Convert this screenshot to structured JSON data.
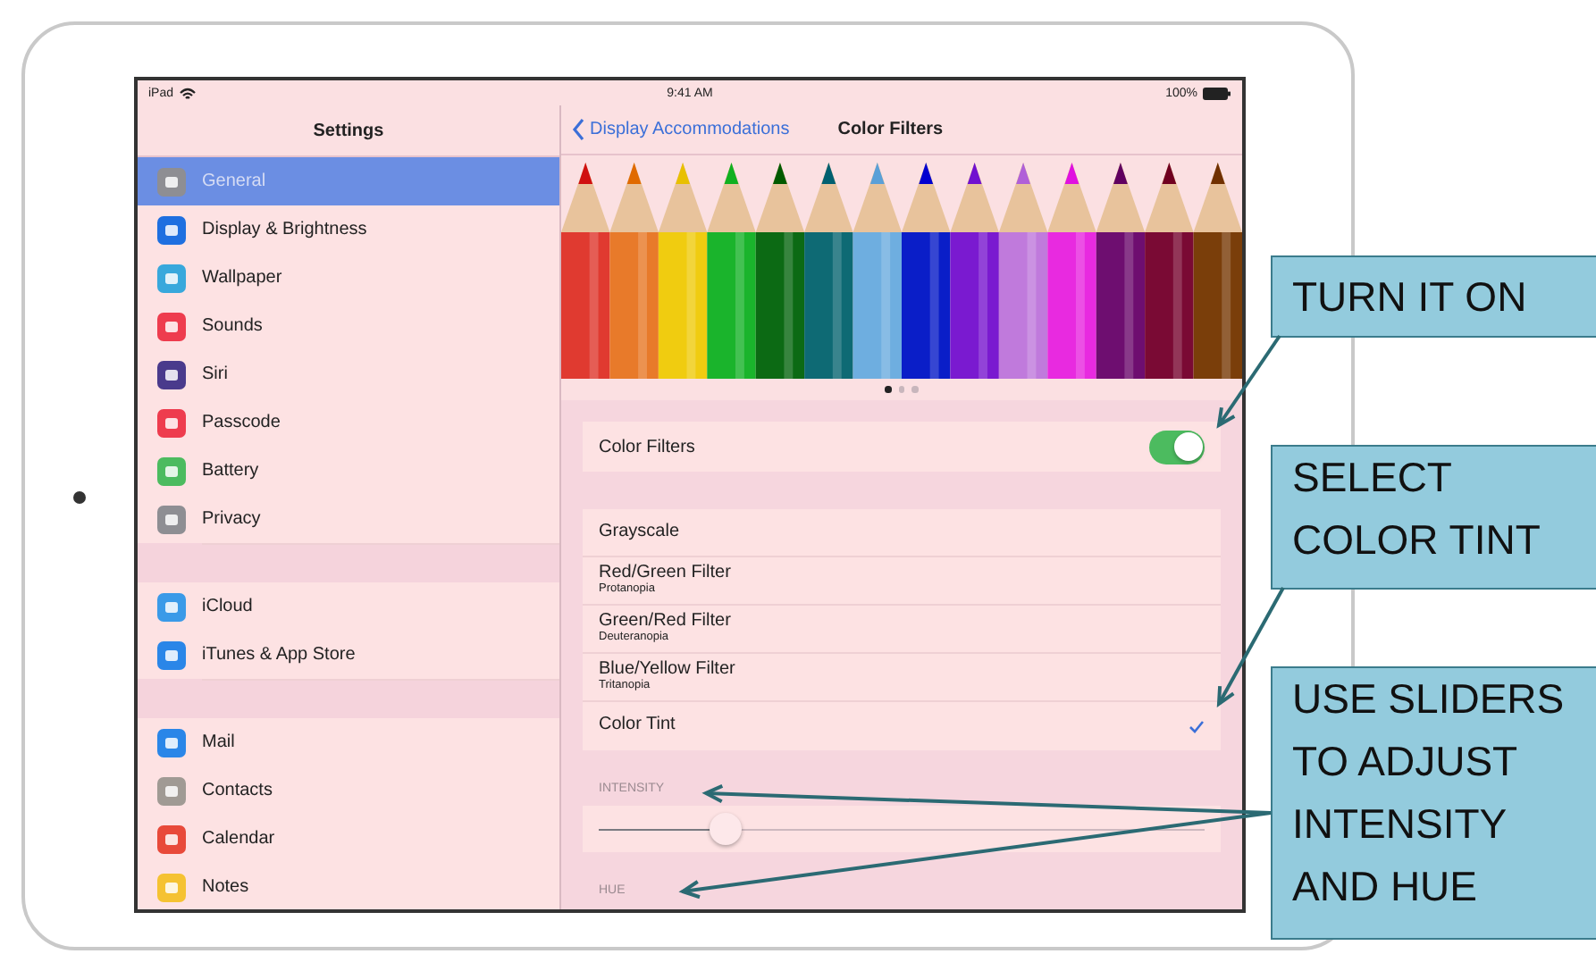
{
  "status_bar": {
    "device": "iPad",
    "time": "9:41 AM",
    "battery": "100%"
  },
  "sidebar": {
    "title": "Settings",
    "groups": [
      {
        "items": [
          {
            "label": "General",
            "color": "#8e8e93",
            "selected": true
          },
          {
            "label": "Display & Brightness",
            "color": "#1e6fe0",
            "selected": false
          },
          {
            "label": "Wallpaper",
            "color": "#38a8dc",
            "selected": false
          },
          {
            "label": "Sounds",
            "color": "#ee3c4e",
            "selected": false
          },
          {
            "label": "Siri",
            "color": "#4a3a8c",
            "selected": false
          },
          {
            "label": "Passcode",
            "color": "#ee3c4e",
            "selected": false
          },
          {
            "label": "Battery",
            "color": "#4cbb5f",
            "selected": false
          },
          {
            "label": "Privacy",
            "color": "#8e8e93",
            "selected": false
          }
        ]
      },
      {
        "items": [
          {
            "label": "iCloud",
            "color": "#3a9ae8",
            "selected": false
          },
          {
            "label": "iTunes & App Store",
            "color": "#2a86e8",
            "selected": false
          }
        ]
      },
      {
        "items": [
          {
            "label": "Mail",
            "color": "#2a86e8",
            "selected": false
          },
          {
            "label": "Contacts",
            "color": "#a09a94",
            "selected": false
          },
          {
            "label": "Calendar",
            "color": "#e84a3a",
            "selected": false
          },
          {
            "label": "Notes",
            "color": "#f5c232",
            "selected": false
          }
        ]
      }
    ]
  },
  "detail": {
    "back": "Display Accommodations",
    "title": "Color Filters",
    "page_dots": [
      {
        "selected": true
      },
      {
        "selected": false
      },
      {
        "selected": false
      }
    ],
    "color_filters": {
      "label": "Color Filters",
      "on": true
    },
    "filters": [
      {
        "label": "Grayscale",
        "selected": false
      },
      {
        "label": "Red/Green Filter",
        "subtitle": "Protanopia",
        "selected": false
      },
      {
        "label": "Green/Red Filter",
        "subtitle": "Deuteranopia",
        "selected": false
      },
      {
        "label": "Blue/Yellow Filter",
        "subtitle": "Tritanopia",
        "selected": false
      },
      {
        "label": "Color Tint",
        "selected": true
      }
    ],
    "intensity": {
      "label": "INTENSITY",
      "level": 0.21
    },
    "hue": {
      "label": "HUE"
    }
  },
  "callouts": [
    {
      "text": "TURN IT ON"
    },
    {
      "text": "SELECT\nCOLOR TINT"
    },
    {
      "text": "USE SLIDERS\nTO ADJUST\nINTENSITY\nAND HUE"
    }
  ]
}
